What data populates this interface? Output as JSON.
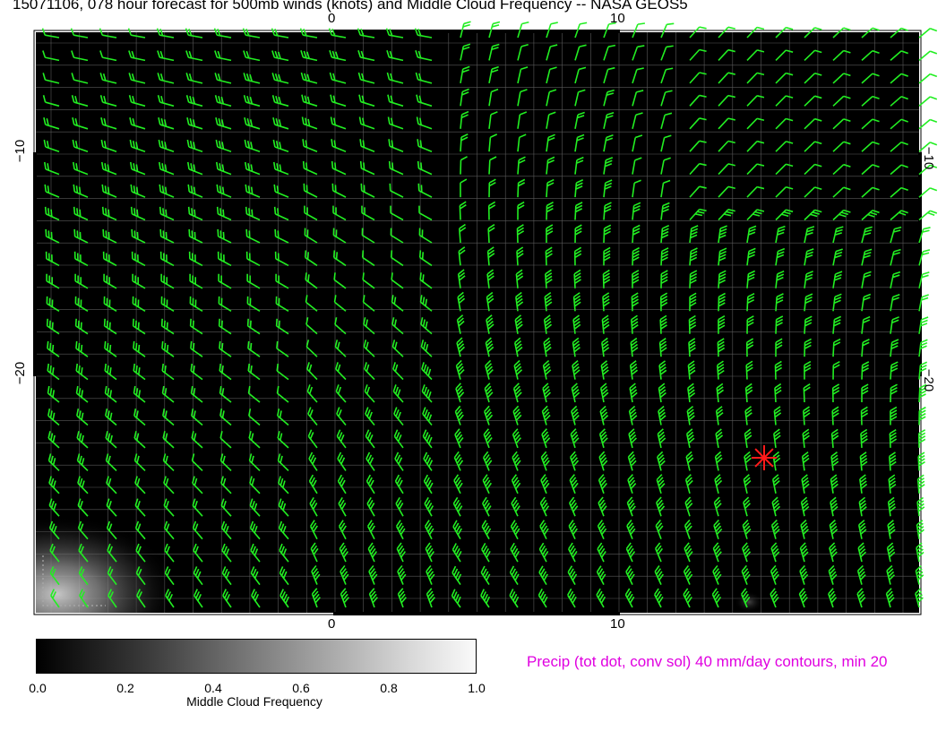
{
  "title": "15071106, 078 hour forecast for 500mb winds (knots) and Middle Cloud Frequency -- NASA GEOS5",
  "axes": {
    "top_ticks": [
      "0",
      "10"
    ],
    "bottom_ticks": [
      "0",
      "10"
    ],
    "left_ticks": [
      "−10",
      "−20"
    ],
    "right_ticks": [
      "−10",
      "−20"
    ]
  },
  "colorbar": {
    "title": "Middle Cloud Frequency",
    "ticks": [
      "0.0",
      "0.2",
      "0.4",
      "0.6",
      "0.8",
      "1.0"
    ]
  },
  "precip_note": "Precip (tot dot, conv sol) 40 mm/day contours, min 20",
  "colors": {
    "barb": "#22ee22",
    "background": "#000000",
    "cyclone_marker": "#ff1a1a",
    "precip_text": "#e000e0"
  },
  "cyclone_marker": {
    "label": "",
    "symbol": "asterisk"
  }
}
